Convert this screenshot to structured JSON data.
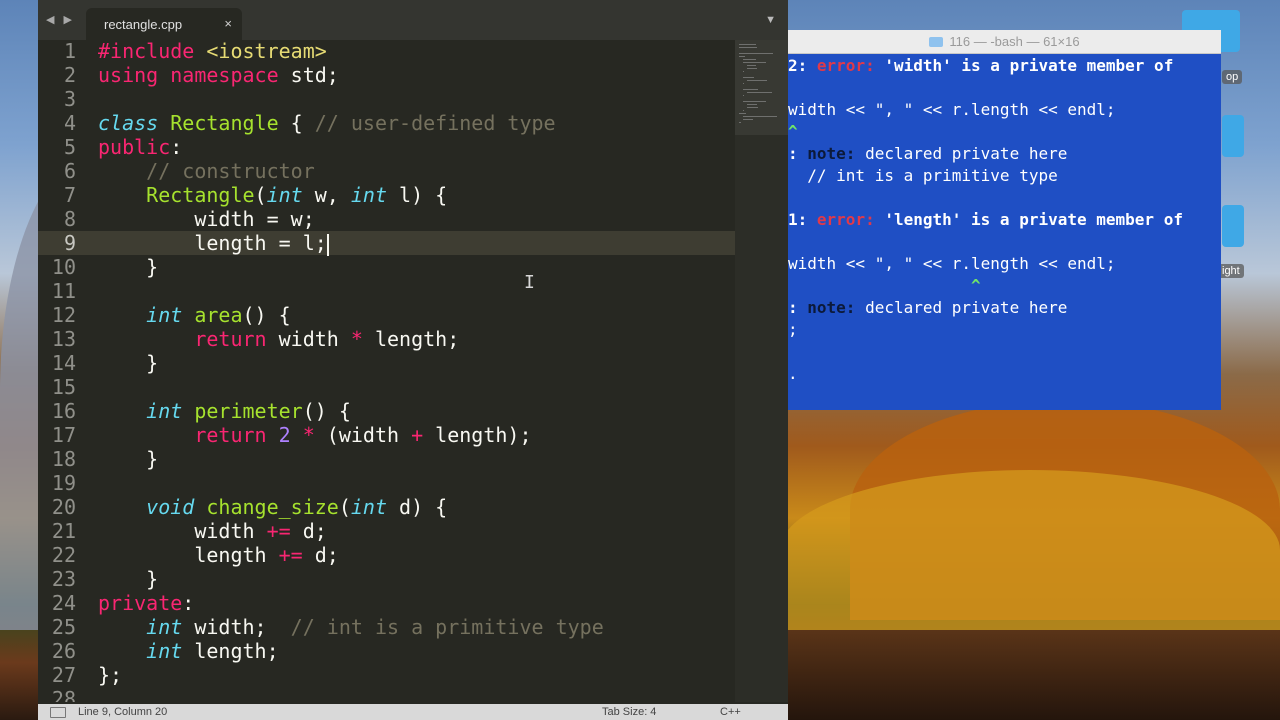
{
  "editor": {
    "tab_filename": "rectangle.cpp",
    "tab_close_glyph": "×",
    "nav_arrows": "◀ ▶",
    "dropdown_glyph": "▼",
    "current_line": 9,
    "code_lines": [
      {
        "num": "1",
        "tokens": [
          {
            "t": "#include ",
            "c": "k-pink"
          },
          {
            "t": "<iostream>",
            "c": "k-yellow"
          }
        ]
      },
      {
        "num": "2",
        "tokens": [
          {
            "t": "using namespace ",
            "c": "k-pink"
          },
          {
            "t": "std;",
            "c": ""
          }
        ]
      },
      {
        "num": "3",
        "tokens": []
      },
      {
        "num": "4",
        "tokens": [
          {
            "t": "class ",
            "c": "k-blue"
          },
          {
            "t": "Rectangle",
            "c": "k-green"
          },
          {
            "t": " { ",
            "c": ""
          },
          {
            "t": "// user-defined type",
            "c": "k-comment"
          }
        ]
      },
      {
        "num": "5",
        "tokens": [
          {
            "t": "public",
            "c": "k-pink"
          },
          {
            "t": ":",
            "c": ""
          }
        ]
      },
      {
        "num": "6",
        "tokens": [
          {
            "t": "    // constructor",
            "c": "k-comment"
          }
        ]
      },
      {
        "num": "7",
        "tokens": [
          {
            "t": "    ",
            "c": ""
          },
          {
            "t": "Rectangle",
            "c": "k-green"
          },
          {
            "t": "(",
            "c": ""
          },
          {
            "t": "int",
            "c": "k-blue"
          },
          {
            "t": " w, ",
            "c": ""
          },
          {
            "t": "int",
            "c": "k-blue"
          },
          {
            "t": " l) {",
            "c": ""
          }
        ]
      },
      {
        "num": "8",
        "tokens": [
          {
            "t": "        width = w;",
            "c": ""
          }
        ]
      },
      {
        "num": "9",
        "tokens": [
          {
            "t": "        length = l;",
            "c": ""
          }
        ],
        "cursor": true
      },
      {
        "num": "10",
        "tokens": [
          {
            "t": "    }",
            "c": ""
          }
        ]
      },
      {
        "num": "11",
        "tokens": []
      },
      {
        "num": "12",
        "tokens": [
          {
            "t": "    ",
            "c": ""
          },
          {
            "t": "int",
            "c": "k-blue"
          },
          {
            "t": " ",
            "c": ""
          },
          {
            "t": "area",
            "c": "k-green"
          },
          {
            "t": "() {",
            "c": ""
          }
        ]
      },
      {
        "num": "13",
        "tokens": [
          {
            "t": "        ",
            "c": ""
          },
          {
            "t": "return",
            "c": "k-pink"
          },
          {
            "t": " width ",
            "c": ""
          },
          {
            "t": "*",
            "c": "k-pink"
          },
          {
            "t": " length;",
            "c": ""
          }
        ]
      },
      {
        "num": "14",
        "tokens": [
          {
            "t": "    }",
            "c": ""
          }
        ]
      },
      {
        "num": "15",
        "tokens": []
      },
      {
        "num": "16",
        "tokens": [
          {
            "t": "    ",
            "c": ""
          },
          {
            "t": "int",
            "c": "k-blue"
          },
          {
            "t": " ",
            "c": ""
          },
          {
            "t": "perimeter",
            "c": "k-green"
          },
          {
            "t": "() {",
            "c": ""
          }
        ]
      },
      {
        "num": "17",
        "tokens": [
          {
            "t": "        ",
            "c": ""
          },
          {
            "t": "return",
            "c": "k-pink"
          },
          {
            "t": " ",
            "c": ""
          },
          {
            "t": "2",
            "c": "k-purple"
          },
          {
            "t": " ",
            "c": ""
          },
          {
            "t": "*",
            "c": "k-pink"
          },
          {
            "t": " (width ",
            "c": ""
          },
          {
            "t": "+",
            "c": "k-pink"
          },
          {
            "t": " length);",
            "c": ""
          }
        ]
      },
      {
        "num": "18",
        "tokens": [
          {
            "t": "    }",
            "c": ""
          }
        ]
      },
      {
        "num": "19",
        "tokens": []
      },
      {
        "num": "20",
        "tokens": [
          {
            "t": "    ",
            "c": ""
          },
          {
            "t": "void",
            "c": "k-blue"
          },
          {
            "t": " ",
            "c": ""
          },
          {
            "t": "change_size",
            "c": "k-green"
          },
          {
            "t": "(",
            "c": ""
          },
          {
            "t": "int",
            "c": "k-blue"
          },
          {
            "t": " d) {",
            "c": ""
          }
        ]
      },
      {
        "num": "21",
        "tokens": [
          {
            "t": "        width ",
            "c": ""
          },
          {
            "t": "+=",
            "c": "k-pink"
          },
          {
            "t": " d;",
            "c": ""
          }
        ]
      },
      {
        "num": "22",
        "tokens": [
          {
            "t": "        length ",
            "c": ""
          },
          {
            "t": "+=",
            "c": "k-pink"
          },
          {
            "t": " d;",
            "c": ""
          }
        ]
      },
      {
        "num": "23",
        "tokens": [
          {
            "t": "    }",
            "c": ""
          }
        ]
      },
      {
        "num": "24",
        "tokens": [
          {
            "t": "private",
            "c": "k-pink"
          },
          {
            "t": ":",
            "c": ""
          }
        ]
      },
      {
        "num": "25",
        "tokens": [
          {
            "t": "    ",
            "c": ""
          },
          {
            "t": "int",
            "c": "k-blue"
          },
          {
            "t": " width;  ",
            "c": ""
          },
          {
            "t": "// int is a primitive type",
            "c": "k-comment"
          }
        ]
      },
      {
        "num": "26",
        "tokens": [
          {
            "t": "    ",
            "c": ""
          },
          {
            "t": "int",
            "c": "k-blue"
          },
          {
            "t": " length;",
            "c": ""
          }
        ]
      },
      {
        "num": "27",
        "tokens": [
          {
            "t": "};",
            "c": ""
          }
        ]
      },
      {
        "num": "28",
        "tokens": []
      }
    ]
  },
  "status_bar": {
    "position": "Line 9, Column 20",
    "tab_size": "Tab Size: 4",
    "syntax": "C++"
  },
  "terminal": {
    "title": "116 — -bash — 61×16",
    "lines": [
      [
        {
          "t": "2: ",
          "c": "t-bold"
        },
        {
          "t": "error:",
          "c": "t-red"
        },
        {
          "t": " 'width' is a private member of",
          "c": "t-bold"
        }
      ],
      [],
      [
        {
          "t": "width << \", \" << r.length << endl;",
          "c": ""
        }
      ],
      [
        {
          "t": "^",
          "c": "t-green"
        }
      ],
      [
        {
          "t": ": ",
          "c": "t-bold"
        },
        {
          "t": "note:",
          "c": "t-dark"
        },
        {
          "t": " declared private here",
          "c": ""
        }
      ],
      [
        {
          "t": "  // int is a primitive type",
          "c": ""
        }
      ],
      [],
      [
        {
          "t": "1: ",
          "c": "t-bold"
        },
        {
          "t": "error:",
          "c": "t-red"
        },
        {
          "t": " 'length' is a private member of",
          "c": "t-bold"
        }
      ],
      [],
      [
        {
          "t": "width << \", \" << r.length << endl;",
          "c": ""
        }
      ],
      [
        {
          "t": "                   ^",
          "c": "t-green"
        }
      ],
      [
        {
          "t": ": ",
          "c": "t-bold"
        },
        {
          "t": "note:",
          "c": "t-dark"
        },
        {
          "t": " declared private here",
          "c": ""
        }
      ],
      [
        {
          "t": ";",
          "c": ""
        }
      ],
      [],
      [
        {
          "t": ".",
          "c": ""
        }
      ]
    ]
  },
  "desktop": {
    "icon_label_1": "op",
    "icon_label_2": "ight"
  },
  "colors": {
    "editor_bg": "#272822",
    "terminal_bg": "#1f4fc4"
  }
}
